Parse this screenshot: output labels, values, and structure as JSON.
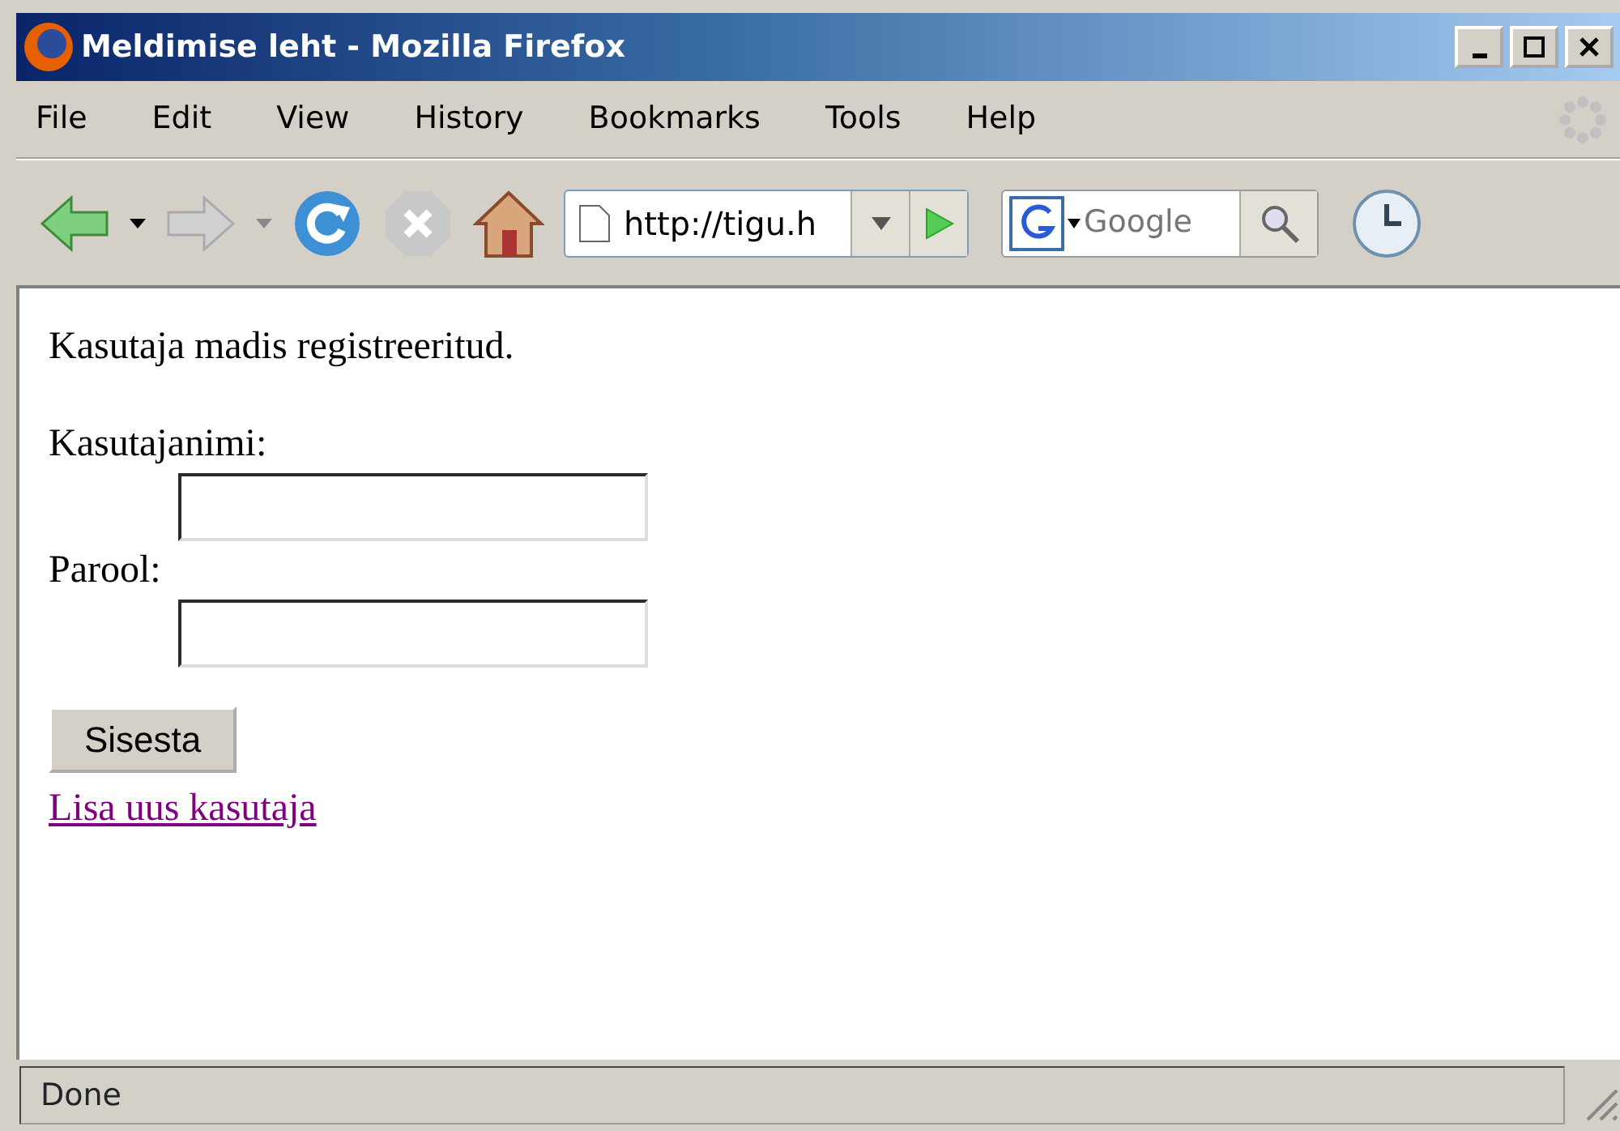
{
  "window": {
    "title": "Meldimise leht - Mozilla Firefox"
  },
  "menu": [
    {
      "label": "File"
    },
    {
      "label": "Edit"
    },
    {
      "label": "View"
    },
    {
      "label": "History"
    },
    {
      "label": "Bookmarks"
    },
    {
      "label": "Tools"
    },
    {
      "label": "Help"
    }
  ],
  "toolbar": {
    "back": {
      "disabled": false
    },
    "forward": {
      "disabled": true
    },
    "stop": {
      "disabled": true
    },
    "url": "http://tigu.h",
    "search": {
      "placeholder": "Google"
    }
  },
  "page": {
    "message": "Kasutaja madis registreeritud.",
    "fields": [
      {
        "label": "Kasutajanimi:"
      },
      {
        "label": "Parool:"
      }
    ],
    "submit": "Sisesta",
    "link": "Lisa uus kasutaja"
  },
  "status_bar": {
    "text": "Done"
  }
}
